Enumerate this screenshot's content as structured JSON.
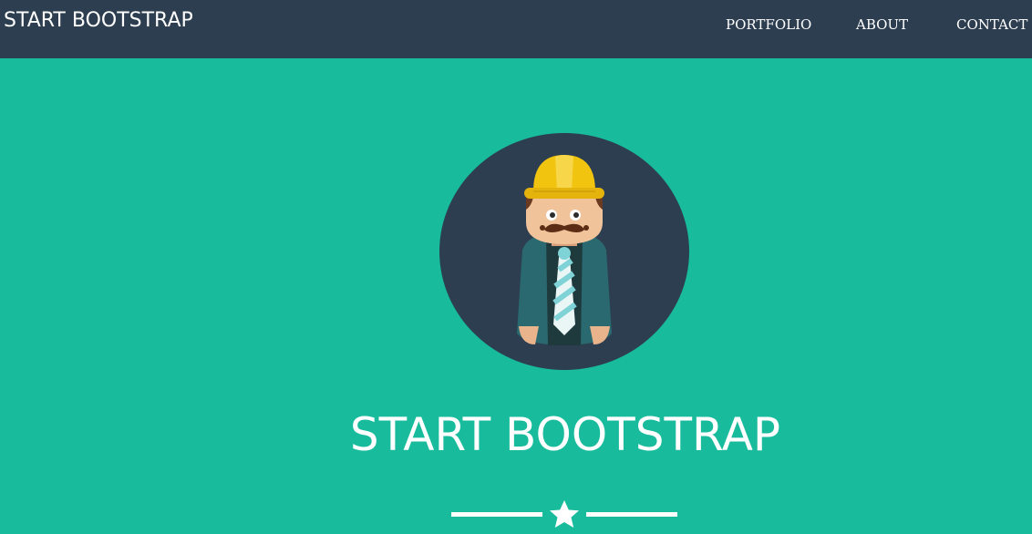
{
  "navbar": {
    "brand": "START BOOTSTRAP",
    "items": [
      {
        "label": "PORTFOLIO"
      },
      {
        "label": "ABOUT"
      },
      {
        "label": "CONTACT"
      }
    ]
  },
  "hero": {
    "title": "START BOOTSTRAP",
    "avatar_icon": "profile-avatar-icon",
    "divider_icon": "star-icon"
  },
  "colors": {
    "navbar_bg": "#2c3e50",
    "hero_bg": "#18bc9c",
    "text": "#ffffff",
    "avatar_circle": "#2c3e50",
    "helmet": "#f1c40f"
  }
}
